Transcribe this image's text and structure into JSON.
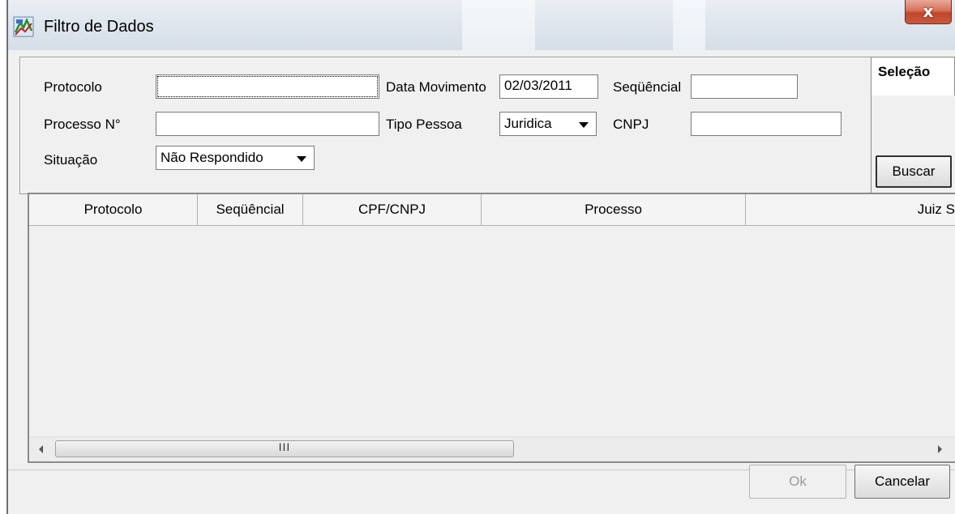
{
  "window": {
    "title": "Filtro de Dados",
    "close_label": "x"
  },
  "form": {
    "protocolo_label": "Protocolo",
    "protocolo_value": "",
    "data_movimento_label": "Data Movimento",
    "data_movimento_value": "02/03/2011",
    "sequencial_label": "Seqüêncial",
    "sequencial_value": "",
    "processo_label": "Processo N°",
    "processo_value": "",
    "tipo_pessoa_label": "Tipo Pessoa",
    "tipo_pessoa_value": "Juridica",
    "cnpj_label": "CNPJ",
    "cnpj_value": "",
    "situacao_label": "Situação",
    "situacao_value": "Não Respondido"
  },
  "tab": {
    "label": "Seleção"
  },
  "buttons": {
    "buscar": "Buscar",
    "ok": "Ok",
    "cancelar": "Cancelar"
  },
  "grid": {
    "columns": [
      "Protocolo",
      "Seqüêncial",
      "CPF/CNPJ",
      "Processo",
      "Juiz S"
    ],
    "rows": [],
    "scroll_thumb_grip": "III"
  },
  "icons": {
    "app": "app-icon",
    "dropdown": "chevron-down-icon",
    "scroll_left": "scroll-left-icon",
    "scroll_right": "scroll-right-icon"
  }
}
